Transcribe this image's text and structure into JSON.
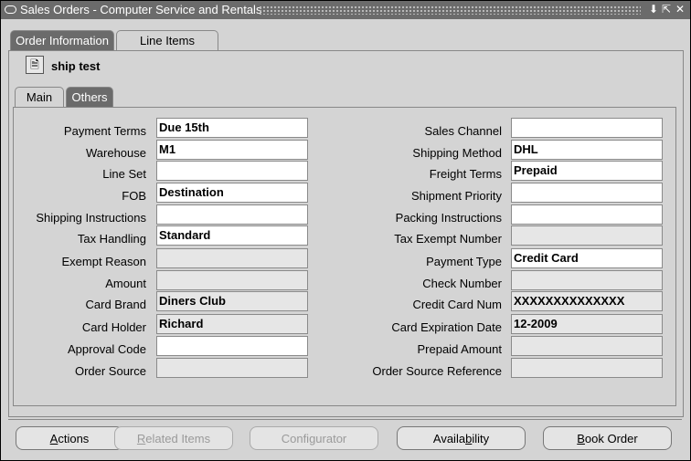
{
  "window": {
    "title": "Sales Orders - Computer Service and Rentals"
  },
  "tabs_top": [
    {
      "label": "Order Information"
    },
    {
      "label": "Line Items"
    }
  ],
  "header": {
    "name": "ship test"
  },
  "tabs_inner": [
    {
      "label": "Main"
    },
    {
      "label": "Others"
    }
  ],
  "left_fields": [
    {
      "label": "Payment Terms",
      "value": "Due 15th"
    },
    {
      "label": "Warehouse",
      "value": "M1"
    },
    {
      "label": "Line Set",
      "value": ""
    },
    {
      "label": "FOB",
      "value": "Destination"
    },
    {
      "label": "Shipping Instructions",
      "value": ""
    },
    {
      "label": "Tax Handling",
      "value": "Standard"
    },
    {
      "label": "Exempt Reason",
      "value": ""
    },
    {
      "label": "Amount",
      "value": ""
    },
    {
      "label": "Card Brand",
      "value": "Diners Club"
    },
    {
      "label": "Card Holder",
      "value": "Richard"
    },
    {
      "label": "Approval Code",
      "value": ""
    },
    {
      "label": "Order Source",
      "value": ""
    }
  ],
  "right_fields": [
    {
      "label": "Sales Channel",
      "value": ""
    },
    {
      "label": "Shipping Method",
      "value": "DHL"
    },
    {
      "label": "Freight Terms",
      "value": "Prepaid"
    },
    {
      "label": "Shipment Priority",
      "value": ""
    },
    {
      "label": "Packing Instructions",
      "value": ""
    },
    {
      "label": "Tax Exempt Number",
      "value": ""
    },
    {
      "label": "Payment Type",
      "value": "Credit Card"
    },
    {
      "label": "Check Number",
      "value": ""
    },
    {
      "label": "Credit Card Num",
      "value": "XXXXXXXXXXXXXX"
    },
    {
      "label": "Card Expiration Date",
      "value": "12-2009"
    },
    {
      "label": "Prepaid Amount",
      "value": ""
    },
    {
      "label": "Order Source Reference",
      "value": ""
    }
  ],
  "buttons": [
    {
      "label_key": "A",
      "label_rest": "ctions"
    },
    {
      "label_key": "R",
      "label_rest": "elated Items"
    },
    {
      "label_key": "C",
      "label_rest": "onfigurator"
    },
    {
      "label_pre": "Availa",
      "label_key": "b",
      "label_rest": "ility"
    },
    {
      "label_key": "B",
      "label_rest": "ook Order"
    }
  ]
}
